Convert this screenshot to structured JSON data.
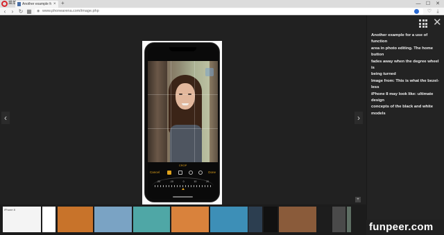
{
  "browser": {
    "menu_label": "菜单",
    "tab_title": "Another example for a u",
    "new_tab": "+",
    "url": "www.phonearena.com/image.php",
    "controls": {
      "minimize": "—",
      "maximize": "☐",
      "close": "✕"
    }
  },
  "viewer": {
    "prev_icon": "chevron-left-icon",
    "next_icon": "chevron-right-icon",
    "photo": {
      "edit_mode_label": "CROP",
      "cancel_label": "Cancel",
      "done_label": "Done",
      "dial_values": [
        "-20",
        "-10",
        "0",
        "10",
        "20"
      ]
    }
  },
  "side_panel": {
    "caption_lines": [
      "Another example for a use of function",
      "area in photo editing. The home button",
      "fades away when the degree wheel is",
      "being turned",
      "Image from: This is what the bezel-less",
      "iPhone 8 may look like: ultimate design",
      "concepts of the black and white models"
    ]
  },
  "thumbnails": [
    {
      "label": "iPhone 8",
      "bg": "#f4f4f4"
    },
    {
      "label": "",
      "bg": "#ffffff"
    },
    {
      "label": "",
      "bg": "#c8732a"
    },
    {
      "label": "",
      "bg": "#7aa3c4"
    },
    {
      "label": "",
      "bg": "#4fa7a6"
    },
    {
      "label": "",
      "bg": "#d9823c"
    },
    {
      "label": "",
      "bg": "#3d8fb7"
    },
    {
      "label": "",
      "bg": "#2c3e50"
    },
    {
      "label": "",
      "bg": "#111111"
    },
    {
      "label": "",
      "bg": "#8a5b3a"
    },
    {
      "label": "",
      "bg": "#1d1d1d"
    },
    {
      "label": "",
      "bg": "#4a4a4a"
    },
    {
      "label": "",
      "bg": "#5d6e63"
    }
  ],
  "watermark": "funpeer.com"
}
